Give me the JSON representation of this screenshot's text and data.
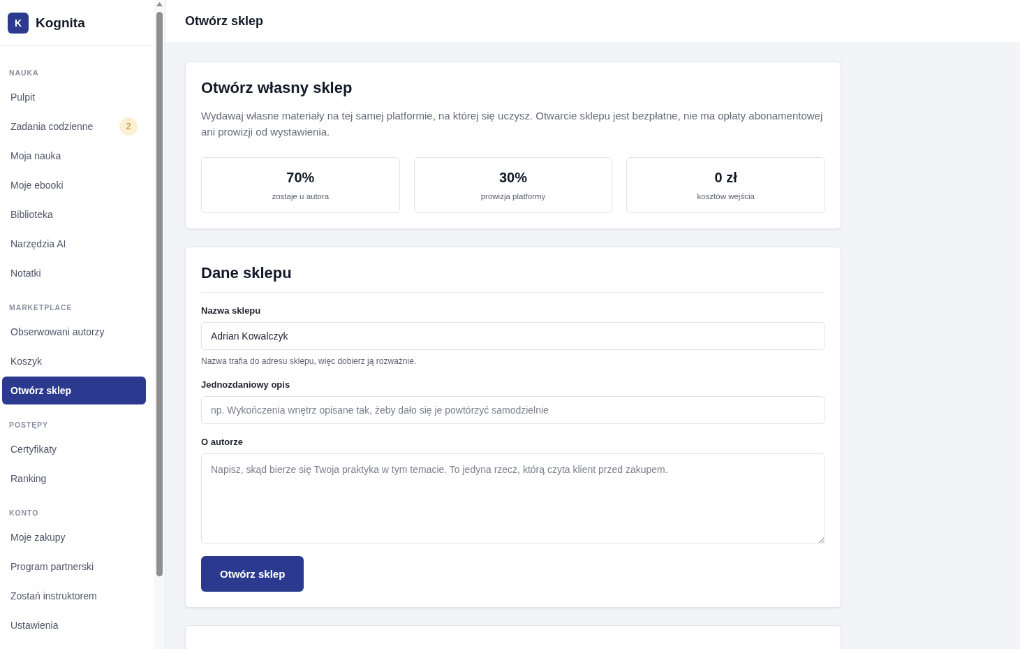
{
  "sidebar": {
    "logo": {
      "letter": "K",
      "name": "Kognita"
    },
    "sections": [
      {
        "label": "NAUKA",
        "items": [
          {
            "label": "Pulpit",
            "selected": false
          },
          {
            "label": "Zadania codzienne",
            "selected": false,
            "badge": "2"
          },
          {
            "label": "Moja nauka",
            "selected": false
          },
          {
            "label": "Moje ebooki",
            "selected": false
          },
          {
            "label": "Biblioteka",
            "selected": false
          },
          {
            "label": "Narzędzia AI",
            "selected": false
          },
          {
            "label": "Notatki",
            "selected": false
          }
        ]
      },
      {
        "label": "MARKETPLACE",
        "items": [
          {
            "label": "Obserwowani autorzy",
            "selected": false
          },
          {
            "label": "Koszyk",
            "selected": false
          },
          {
            "label": "Otwórz sklep",
            "selected": true
          }
        ]
      },
      {
        "label": "POSTĘPY",
        "items": [
          {
            "label": "Certyfikaty",
            "selected": false
          },
          {
            "label": "Ranking",
            "selected": false
          }
        ]
      },
      {
        "label": "KONTO",
        "items": [
          {
            "label": "Moje zakupy",
            "selected": false
          },
          {
            "label": "Program partnerski",
            "selected": false
          },
          {
            "label": "Zostań instruktorem",
            "selected": false
          },
          {
            "label": "Ustawienia",
            "selected": false
          }
        ]
      }
    ]
  },
  "header": {
    "title": "Otwórz sklep"
  },
  "intro_card": {
    "title": "Otwórz własny sklep",
    "description": "Wydawaj własne materiały na tej samej platformie, na której się uczysz. Otwarcie sklepu jest bezpłatne, nie ma opłaty abonamentowej ani prowizji od wystawienia.",
    "stats": [
      {
        "value": "70%",
        "label": "zostaje u autora"
      },
      {
        "value": "30%",
        "label": "prowizja platformy"
      },
      {
        "value": "0 zł",
        "label": "kosztów wejścia"
      }
    ]
  },
  "form_card": {
    "title": "Dane sklepu",
    "fields": [
      {
        "kind": "input",
        "label": "Nazwa sklepu",
        "value": "Adrian Kowalczyk",
        "hint": "Nazwa trafia do adresu sklepu, więc dobierz ją rozważnie."
      },
      {
        "kind": "input",
        "label": "Jednozdaniowy opis",
        "placeholder": "np. Wykończenia wnętrz opisane tak, żeby dało się je powtórzyć samodzielnie"
      },
      {
        "kind": "textarea",
        "label": "O autorze",
        "placeholder": "Napisz, skąd bierze się Twoja praktyka w tym temacie. To jedyna rzecz, którą czyta klient przed zakupem."
      }
    ],
    "submit": "Otwórz sklep"
  }
}
